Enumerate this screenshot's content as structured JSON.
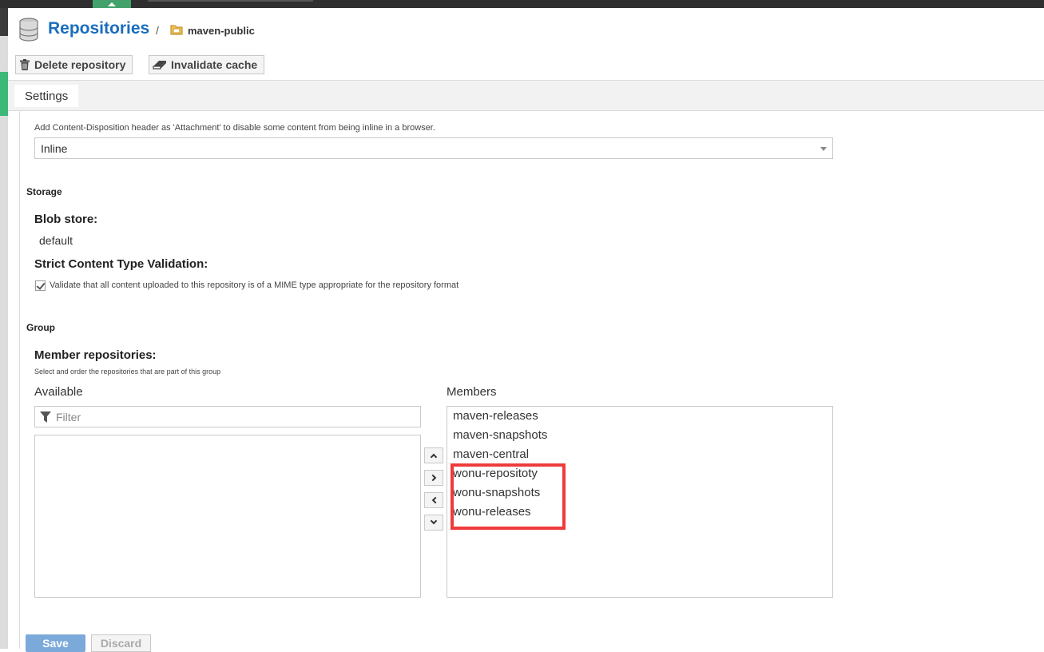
{
  "header": {
    "title": "Repositories",
    "separator": "/",
    "breadcrumb": "maven-public",
    "icon": "database-icon",
    "breadcrumb_icon": "folder-icon"
  },
  "toolbar": {
    "delete_label": "Delete repository",
    "invalidate_label": "Invalidate cache"
  },
  "tabs": {
    "settings": "Settings"
  },
  "content_disposition": {
    "help": "Add Content-Disposition header as 'Attachment' to disable some content from being inline in a browser.",
    "value": "Inline"
  },
  "storage": {
    "section": "Storage",
    "blob_label": "Blob store:",
    "blob_value": "default",
    "strict_label": "Strict Content Type Validation:",
    "strict_checkbox_label": "Validate that all content uploaded to this repository is of a MIME type appropriate for the repository format",
    "strict_checked": true
  },
  "group": {
    "section": "Group",
    "members_label": "Member repositories:",
    "members_help": "Select and order the repositories that are part of this group",
    "available_head": "Available",
    "members_head": "Members",
    "filter_placeholder": "Filter",
    "members": [
      "maven-releases",
      "maven-snapshots",
      "maven-central",
      "wonu-repositoty",
      "wonu-snapshots",
      "wonu-releases"
    ]
  },
  "footer": {
    "save_label": "Save",
    "discard_label": "Discard"
  },
  "colors": {
    "accent": "#1a6dbd",
    "highlight": "#ef3b3b",
    "nav_green": "#3cb878"
  }
}
